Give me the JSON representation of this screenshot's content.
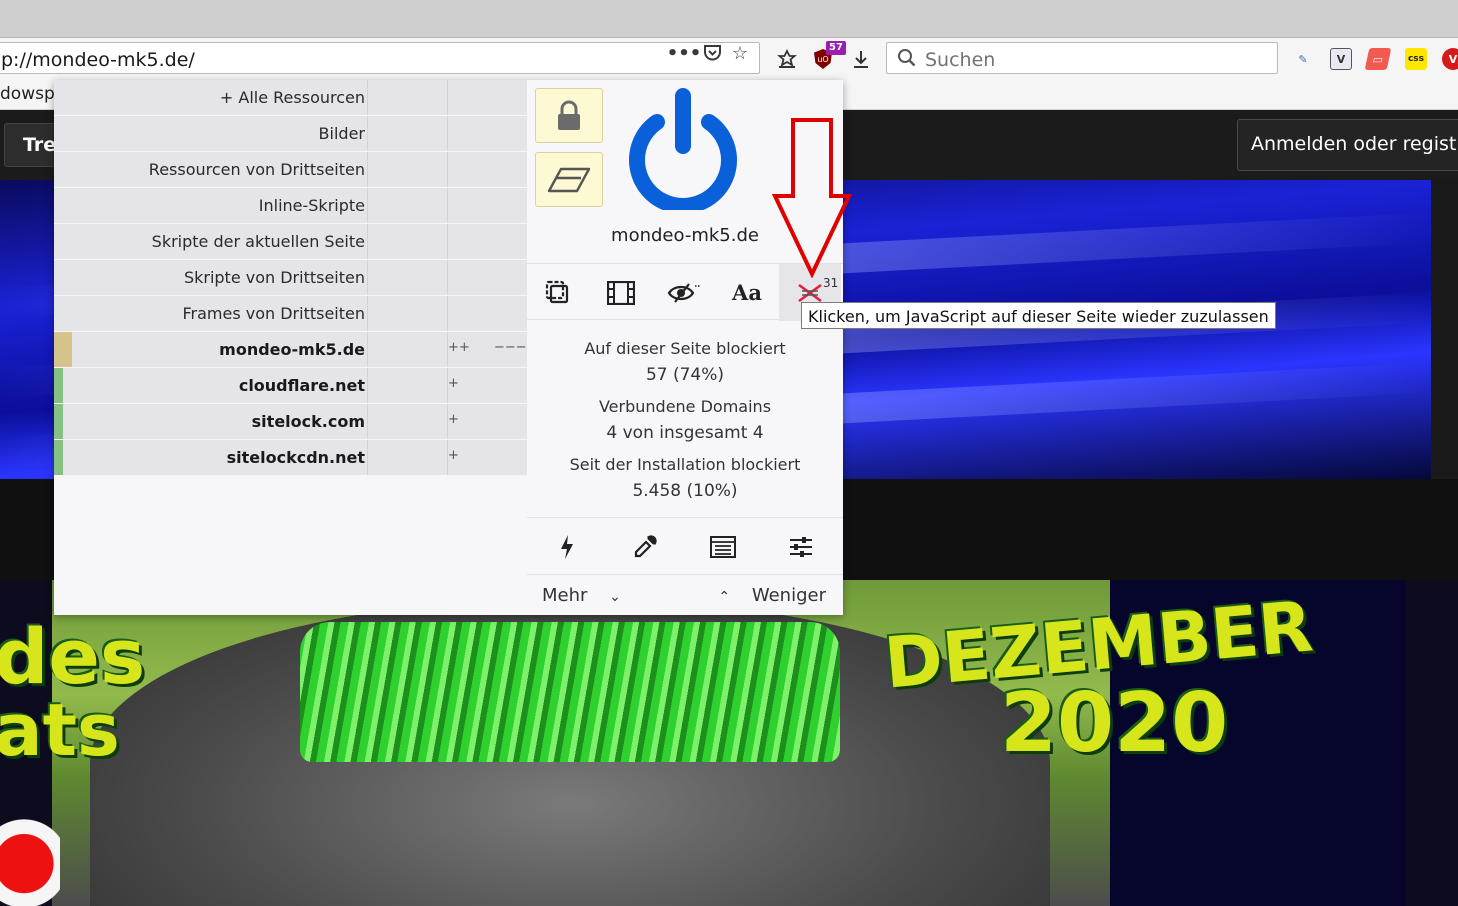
{
  "browser": {
    "url": "p://mondeo-mk5.de/",
    "search_placeholder": "Suchen",
    "ublock_badge": "57",
    "bookmark_partial": "dowspc",
    "icons": [
      "more-actions-icon",
      "pocket-icon",
      "star-icon",
      "library-icon",
      "ublock-icon",
      "download-icon",
      "search-icon"
    ]
  },
  "page": {
    "tre_label": "Tre",
    "login_label": "Anmelden oder registri",
    "banner_left_line1": "des",
    "banner_left_line2": "ats",
    "banner_month": "DEZEMBER",
    "banner_year": "2020"
  },
  "panel": {
    "firewall_rows": [
      {
        "label": "+ Alle Ressourcen",
        "bold": false,
        "cell1": "",
        "cell2": ""
      },
      {
        "label": "Bilder",
        "bold": false,
        "cell1": "",
        "cell2": ""
      },
      {
        "label": "Ressourcen von Drittseiten",
        "bold": false,
        "cell1": "",
        "cell2": ""
      },
      {
        "label": "Inline-Skripte",
        "bold": false,
        "cell1": "",
        "cell2": ""
      },
      {
        "label": "Skripte der aktuellen Seite",
        "bold": false,
        "cell1": "",
        "cell2": ""
      },
      {
        "label": "Skripte von Drittseiten",
        "bold": false,
        "cell1": "",
        "cell2": ""
      },
      {
        "label": "Frames von Drittseiten",
        "bold": false,
        "cell1": "",
        "cell2": ""
      },
      {
        "label": "mondeo-mk5.de",
        "bold": true,
        "cell1": "++",
        "cell2": "−−−"
      },
      {
        "label": "cloudflare.net",
        "bold": true,
        "cell1": "+",
        "cell2": ""
      },
      {
        "label": "sitelock.com",
        "bold": true,
        "cell1": "+",
        "cell2": ""
      },
      {
        "label": "sitelockcdn.net",
        "bold": true,
        "cell1": "+",
        "cell2": ""
      }
    ],
    "hostname": "mondeo-mk5.de",
    "js_count": "31",
    "stats": {
      "blocked_page_label": "Auf dieser Seite blockiert",
      "blocked_page_value": "57 (74%)",
      "domains_label": "Verbundene Domains",
      "domains_value": "4 von insgesamt 4",
      "since_install_label": "Seit der Installation blockiert",
      "since_install_value": "5.458 (10%)"
    },
    "more_label": "Mehr",
    "less_label": "Weniger",
    "tooltip": "Klicken, um JavaScript auf dieser Seite wieder zuzulassen"
  },
  "colors": {
    "power_blue": "#0a60d9",
    "arrow_red": "#e00000",
    "local_bar": "#d4c38b",
    "third_party_bar": "#86c184",
    "lock_button_bg": "#fdf9d3"
  }
}
